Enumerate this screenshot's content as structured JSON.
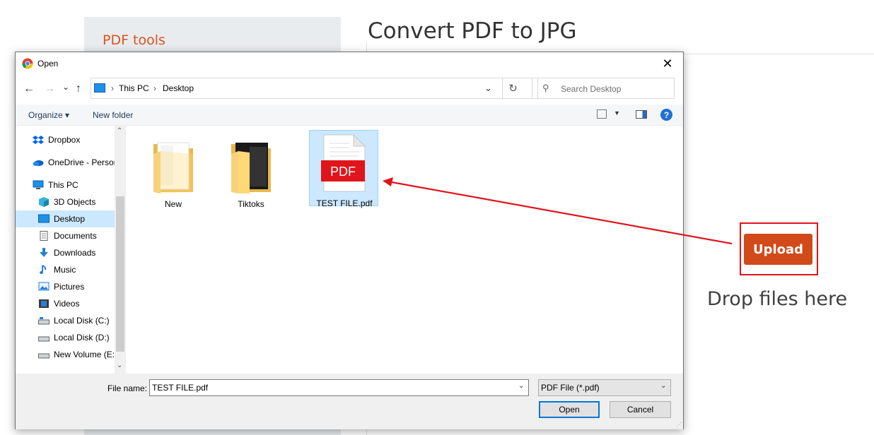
{
  "page": {
    "sidebar_title": "PDF tools",
    "title": "Convert PDF to JPG",
    "upload_label": "Upload",
    "drop_text": "Drop files here",
    "accent_color": "#d2491a",
    "annotation_color": "#e0141b"
  },
  "dialog": {
    "title": "Open",
    "close_glyph": "✕",
    "back_glyph": "←",
    "forward_glyph": "→",
    "recent_glyph": "⌄",
    "up_glyph": "↑",
    "breadcrumb": [
      "This PC",
      "Desktop"
    ],
    "crumb_separator": "›",
    "address_dropdown_glyph": "⌄",
    "refresh_glyph": "↻",
    "search_placeholder": "Search Desktop",
    "search_glyph": "⚲",
    "toolbar": {
      "organize": "Organize ▾",
      "new_folder": "New folder",
      "help": "?",
      "view_dropdown": "▼"
    },
    "nav_items": [
      {
        "label": "Dropbox",
        "icon": "dropbox-icon"
      },
      {
        "label": "OneDrive - Person",
        "icon": "onedrive-icon"
      },
      {
        "label": "This PC",
        "icon": "pc-icon"
      },
      {
        "label": "3D Objects",
        "icon": "cube-icon"
      },
      {
        "label": "Desktop",
        "icon": "desktop-icon",
        "selected": true
      },
      {
        "label": "Documents",
        "icon": "document-icon"
      },
      {
        "label": "Downloads",
        "icon": "download-icon"
      },
      {
        "label": "Music",
        "icon": "music-icon"
      },
      {
        "label": "Pictures",
        "icon": "pictures-icon"
      },
      {
        "label": "Videos",
        "icon": "videos-icon"
      },
      {
        "label": "Local Disk (C:)",
        "icon": "drive-icon"
      },
      {
        "label": "Local Disk (D:)",
        "icon": "drive-icon"
      },
      {
        "label": "New Volume (E:)",
        "icon": "drive-icon"
      }
    ],
    "scroll_up_glyph": "⌃",
    "scroll_down_glyph": "⌄",
    "files": [
      {
        "label": "New",
        "icon": "folder-icon"
      },
      {
        "label": "Tiktoks",
        "icon": "folder-icon"
      },
      {
        "label": "TEST FILE.pdf",
        "icon": "pdf-icon",
        "selected": true
      }
    ],
    "pdf_badge": "PDF",
    "file_name_label": "File name:",
    "file_name_value": "TEST FILE.pdf",
    "file_type": "PDF File (*.pdf)",
    "dropdown_glyph": "⌄",
    "open_label": "Open",
    "cancel_label": "Cancel",
    "grip_glyph": "⋰"
  }
}
